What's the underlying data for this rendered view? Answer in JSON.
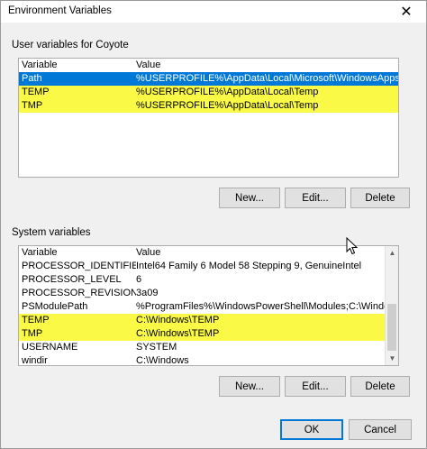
{
  "window": {
    "title": "Environment Variables",
    "close_glyph": "✕"
  },
  "user_vars": {
    "label": "User variables for Coyote",
    "headers": {
      "variable": "Variable",
      "value": "Value"
    },
    "rows": [
      {
        "variable": "Path",
        "value": "%USERPROFILE%\\AppData\\Local\\Microsoft\\WindowsApps;",
        "state": "selected"
      },
      {
        "variable": "TEMP",
        "value": "%USERPROFILE%\\AppData\\Local\\Temp",
        "state": "highlight"
      },
      {
        "variable": "TMP",
        "value": "%USERPROFILE%\\AppData\\Local\\Temp",
        "state": "highlight"
      }
    ],
    "buttons": {
      "new": "New...",
      "edit": "Edit...",
      "delete": "Delete"
    }
  },
  "system_vars": {
    "label": "System variables",
    "headers": {
      "variable": "Variable",
      "value": "Value"
    },
    "rows": [
      {
        "variable": "PROCESSOR_IDENTIFIER",
        "value": "Intel64 Family 6 Model 58 Stepping 9, GenuineIntel",
        "state": "normal"
      },
      {
        "variable": "PROCESSOR_LEVEL",
        "value": "6",
        "state": "normal"
      },
      {
        "variable": "PROCESSOR_REVISION",
        "value": "3a09",
        "state": "normal"
      },
      {
        "variable": "PSModulePath",
        "value": "%ProgramFiles%\\WindowsPowerShell\\Modules;C:\\Windows\\syste...",
        "state": "normal"
      },
      {
        "variable": "TEMP",
        "value": "C:\\Windows\\TEMP",
        "state": "highlight"
      },
      {
        "variable": "TMP",
        "value": "C:\\Windows\\TEMP",
        "state": "highlight"
      },
      {
        "variable": "USERNAME",
        "value": "SYSTEM",
        "state": "normal"
      },
      {
        "variable": "windir",
        "value": "C:\\Windows",
        "state": "normal"
      }
    ],
    "buttons": {
      "new": "New...",
      "edit": "Edit...",
      "delete": "Delete"
    }
  },
  "footer": {
    "ok": "OK",
    "cancel": "Cancel"
  },
  "colors": {
    "selection": "#0078d7",
    "highlight": "#fafa46",
    "dialog_bg": "#f0f0f0"
  },
  "icons": [
    "close-icon",
    "scroll-up-icon",
    "scroll-down-icon",
    "mouse-pointer-icon"
  ]
}
